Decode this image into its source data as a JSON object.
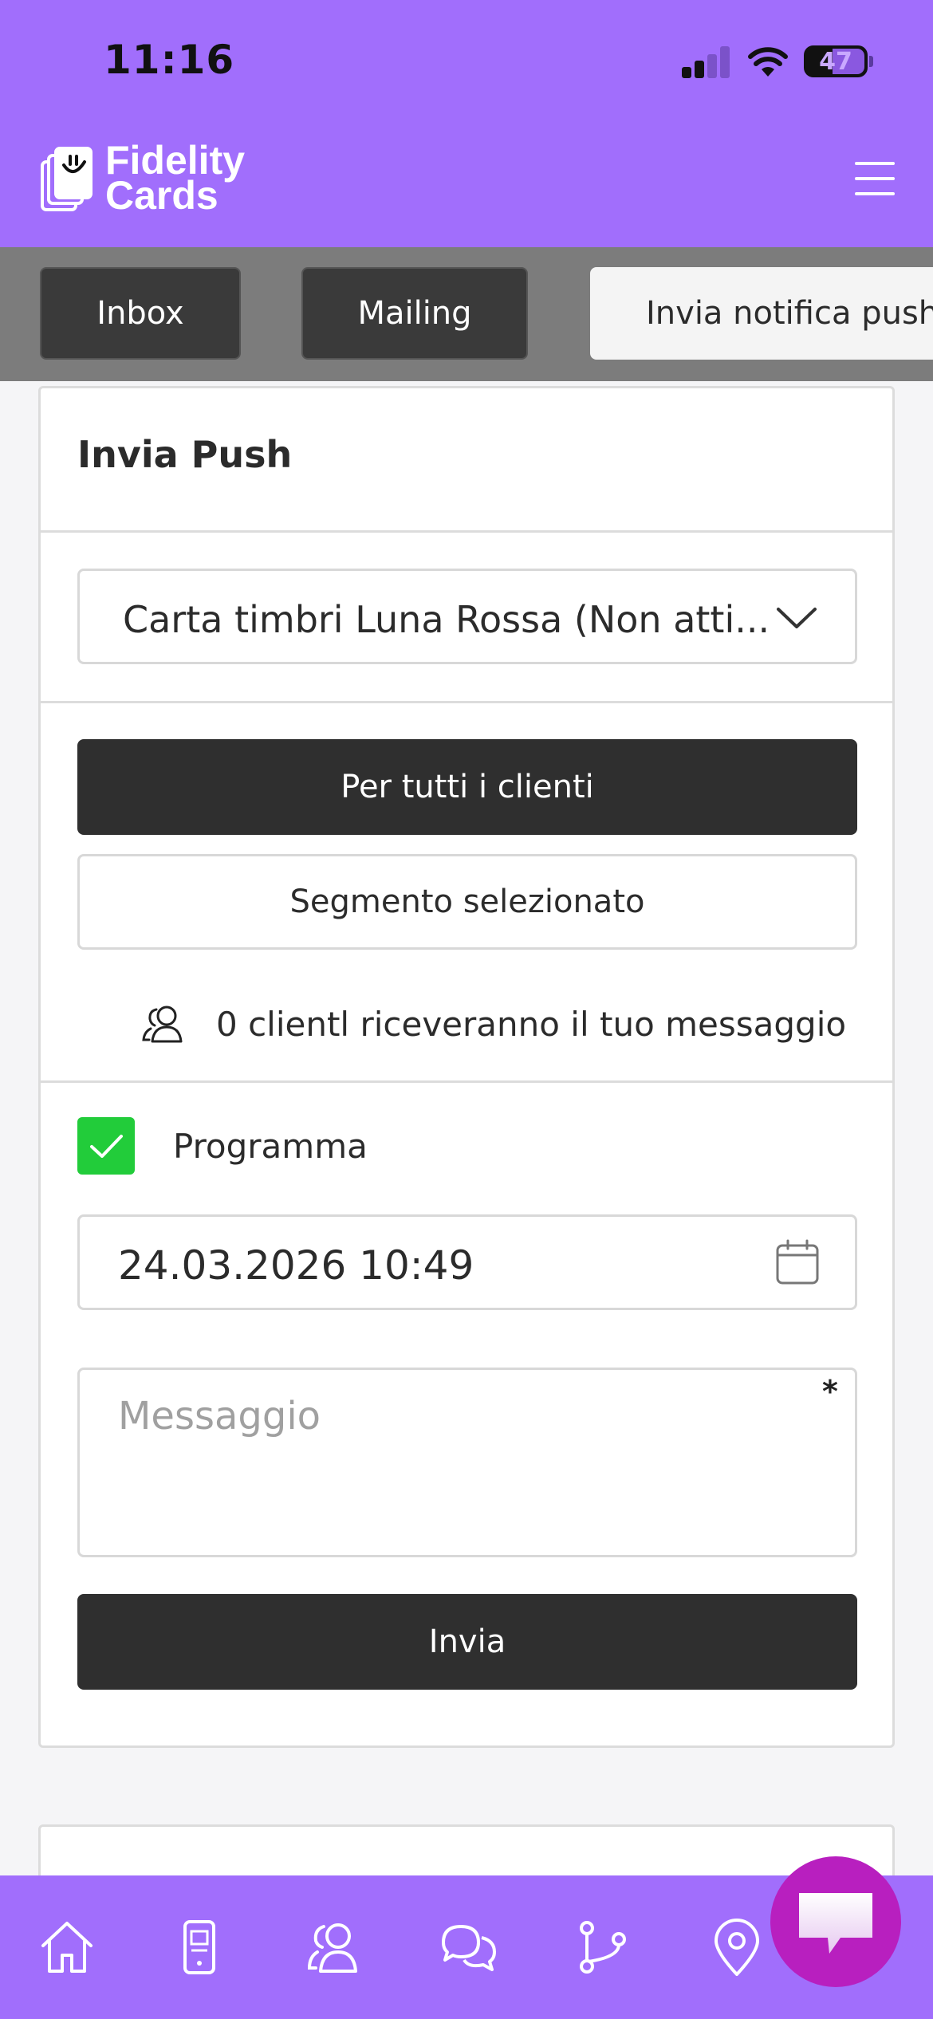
{
  "status_bar": {
    "time": "11:16",
    "battery": "47"
  },
  "header": {
    "logo_line1": "Fidelity",
    "logo_line2": "Cards",
    "brand_color": "#a16efc"
  },
  "tabs": [
    {
      "label": "Inbox"
    },
    {
      "label": "Mailing"
    },
    {
      "label": "Invia notifica push"
    }
  ],
  "push_form": {
    "title": "Invia Push",
    "card_select": "Carta timbri Luna Rossa (Non atti...",
    "audience_all": "Per tutti i clienti",
    "audience_segment": "Segmento selezionato",
    "recipients_text": "0 clientl riceveranno il tuo messaggio",
    "schedule_label": "Programma",
    "schedule_checked": true,
    "schedule_datetime": "24.03.2026 10:49",
    "message_placeholder": "Messaggio",
    "required_mark": "*",
    "submit_label": "Invia"
  },
  "bottom_nav": {
    "items": [
      "home-icon",
      "phone-card-icon",
      "customers-icon",
      "chat-icon",
      "branch-icon",
      "location-icon"
    ]
  },
  "colors": {
    "accent": "#a16efc",
    "check_green": "#22cc3a",
    "chat_fab": "#b81fbf",
    "dark_button": "#2f2f2f"
  }
}
